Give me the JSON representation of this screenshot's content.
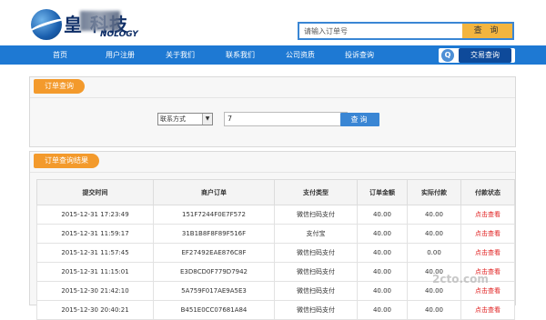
{
  "header": {
    "logo_text": "皇    科技",
    "logo_sub": "NOLOGY",
    "search_placeholder": "请输入订单号",
    "search_button": "查 询"
  },
  "nav": {
    "items": [
      "首页",
      "用户注册",
      "关于我们",
      "联系我们",
      "公司资质",
      "投诉查询"
    ],
    "order_query": "交易查询"
  },
  "query_panel": {
    "title": "订单查询",
    "select_value": "联系方式",
    "input_value": "7",
    "button": "查询"
  },
  "results_panel": {
    "title": "订单查询结果",
    "columns": [
      "提交时间",
      "商户订单",
      "支付类型",
      "订单金额",
      "实际付款",
      "付款状态"
    ],
    "rows": [
      [
        "2015-12-31 17:23:49",
        "151F7244F0E7F572",
        "微信扫码支付",
        "40.00",
        "40.00",
        "点击查看"
      ],
      [
        "2015-12-31 11:59:17",
        "31B1B8F8F89F516F",
        "支付宝",
        "40.00",
        "40.00",
        "点击查看"
      ],
      [
        "2015-12-31 11:57:45",
        "EF27492EAE876C8F",
        "微信扫码支付",
        "40.00",
        "0.00",
        "点击查看"
      ],
      [
        "2015-12-31 11:15:01",
        "E3D8CD0F779D7942",
        "微信扫码支付",
        "40.00",
        "40.00",
        "点击查看"
      ],
      [
        "2015-12-30 21:42:10",
        "5A759F017AE9A5E3",
        "微信扫码支付",
        "40.00",
        "40.00",
        "点击查看"
      ],
      [
        "2015-12-30 20:40:21",
        "B451E0CC07681A84",
        "微信扫码支付",
        "40.00",
        "40.00",
        "点击查看"
      ]
    ]
  },
  "watermark": "2cto.com",
  "colors": {
    "nav": "#1e79d3",
    "accent_orange": "#f39a2c",
    "search_button": "#f3b53f",
    "status_link": "#e02020"
  }
}
